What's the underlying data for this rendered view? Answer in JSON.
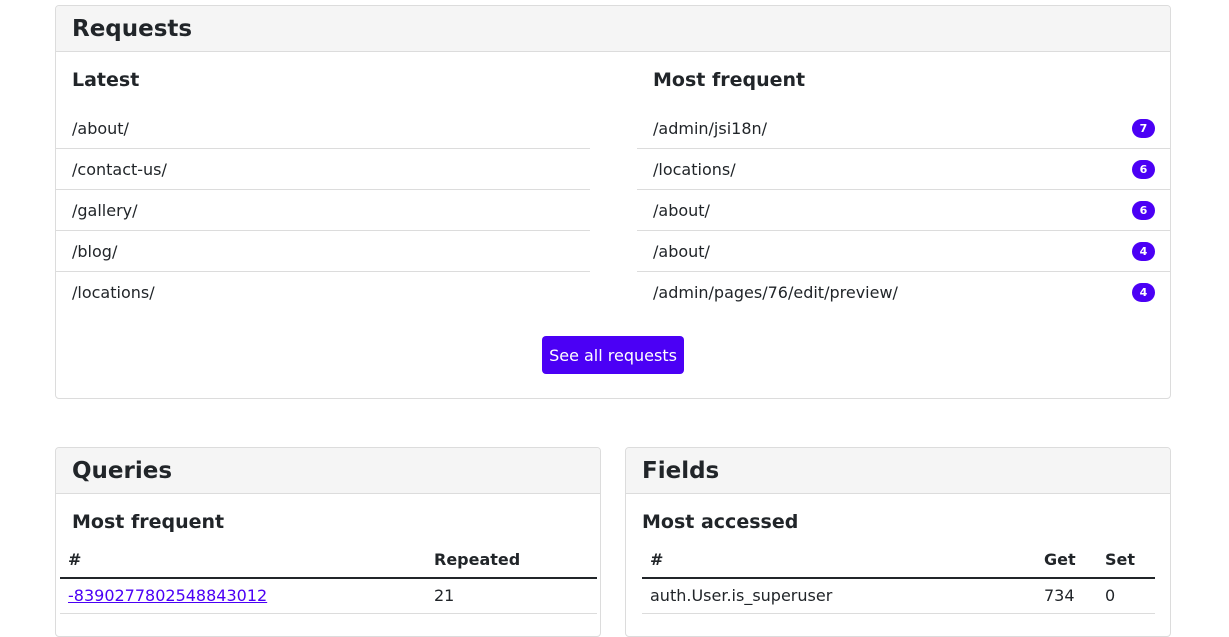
{
  "requests": {
    "title": "Requests",
    "latest": {
      "heading": "Latest",
      "items": [
        "/about/",
        "/contact-us/",
        "/gallery/",
        "/blog/",
        "/locations/"
      ]
    },
    "most_frequent": {
      "heading": "Most frequent",
      "items": [
        {
          "path": "/admin/jsi18n/",
          "count": "7"
        },
        {
          "path": "/locations/",
          "count": "6"
        },
        {
          "path": "/about/",
          "count": "6"
        },
        {
          "path": "/about/",
          "count": "4"
        },
        {
          "path": "/admin/pages/76/edit/preview/",
          "count": "4"
        }
      ]
    },
    "see_all_label": "See all requests"
  },
  "queries": {
    "title": "Queries",
    "heading": "Most frequent",
    "columns": [
      "#",
      "Repeated"
    ],
    "rows": [
      {
        "id": "-8390277802548843012",
        "repeated": "21"
      }
    ]
  },
  "fields": {
    "title": "Fields",
    "heading": "Most accessed",
    "columns": [
      "#",
      "Get",
      "Set"
    ],
    "rows": [
      {
        "name": "auth.User.is_superuser",
        "get": "734",
        "set": "0"
      }
    ]
  },
  "colors": {
    "accent": "#4b00f5",
    "header_bg": "#f5f5f5",
    "border": "#dcdcdc"
  }
}
